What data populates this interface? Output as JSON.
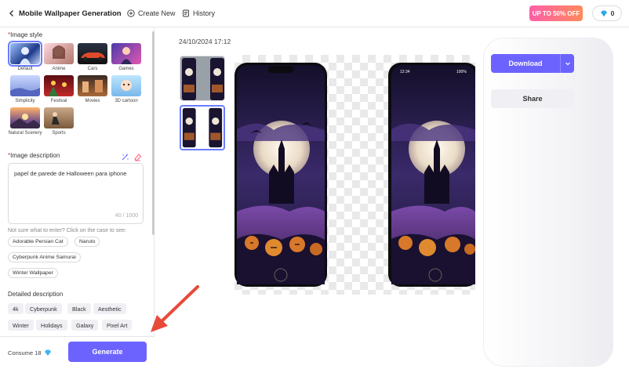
{
  "header": {
    "title": "Mobile Wallpaper Generation",
    "create_new": "Create New",
    "history": "History",
    "promo": "UP TO 50% OFF",
    "gem_count": "0"
  },
  "left": {
    "image_style_label": "Image style",
    "styles": [
      {
        "name": "Default",
        "selected": true
      },
      {
        "name": "Anime"
      },
      {
        "name": "Cars"
      },
      {
        "name": "Games"
      },
      {
        "name": "Simplicity"
      },
      {
        "name": "Festival"
      },
      {
        "name": "Movies"
      },
      {
        "name": "3D cartoon"
      },
      {
        "name": "Natural Scenery"
      },
      {
        "name": "Sports"
      }
    ],
    "image_description_label": "Image description",
    "description_value": "papel de parede de Halloween para iphone",
    "char_count": "40 / 1000",
    "hint": "Not sure what to enter? Click on the case to see:",
    "examples": [
      "Adorable Persian Cat",
      "Naruto",
      "Cyberpunk Anime Samurai",
      "Winter Wallpaper"
    ],
    "detailed_label": "Detailed description",
    "tags": [
      "4k",
      "Cyberpunk",
      "Black",
      "Aesthetic",
      "Winter",
      "Holidays",
      "Galaxy",
      "Pixel Art"
    ],
    "consume_text": "Consume 18",
    "generate_label": "Generate"
  },
  "main": {
    "timestamp": "24/10/2024 17:12",
    "download_label": "Download",
    "share_label": "Share",
    "phone_status": "12:34",
    "phone_battery": "100%"
  }
}
